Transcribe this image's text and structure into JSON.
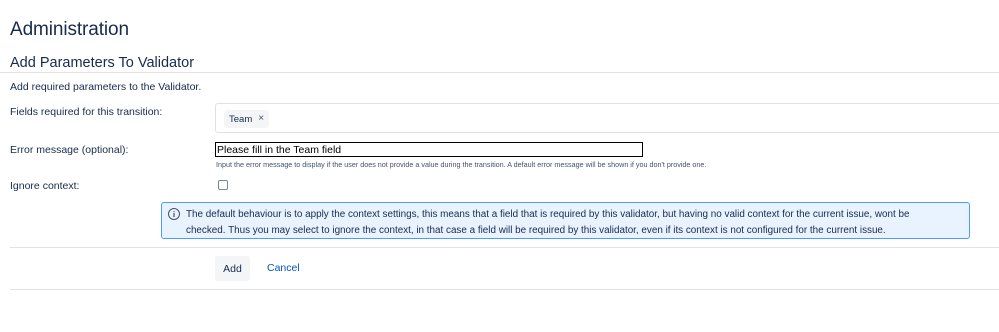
{
  "header": {
    "title": "Administration"
  },
  "section": {
    "title": "Add Parameters To Validator",
    "subtitle": "Add required parameters to the Validator."
  },
  "form": {
    "fields_label": "Fields required for this transition:",
    "fields_selected": [
      {
        "label": "Team",
        "remove_symbol": "×"
      }
    ],
    "error_label": "Error message (optional):",
    "error_value": "Please fill in the Team field",
    "error_help": "Input the error message to display if the user does not provide a value during the transition. A default error message will be shown if you don't provide one.",
    "ignore_label": "Ignore context:",
    "ignore_checked": false,
    "info_icon": "info-icon",
    "info_line1": "The default behaviour is to apply the context settings, this means that a field that is required by this validator, but having no valid context for the current issue, wont be",
    "info_line2": "checked. Thus you may select to ignore the context, in that case a field will be required by this validator, even if its context is not configured for the current issue."
  },
  "actions": {
    "add_label": "Add",
    "cancel_label": "Cancel"
  },
  "colors": {
    "link": "#0052cc",
    "info_bg": "#e9f2ff",
    "info_border": "#4c9aff",
    "text": "#172b4d"
  }
}
